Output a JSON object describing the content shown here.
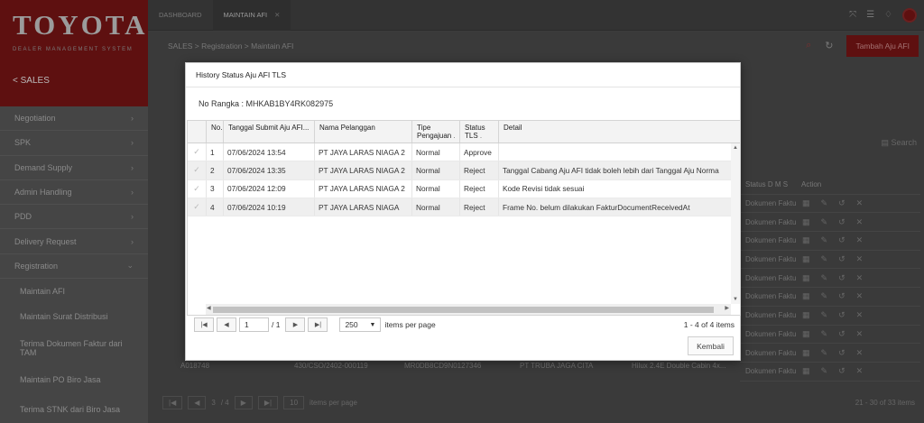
{
  "brand": {
    "name": "TOYOTA",
    "subtitle": "DEALER MANAGEMENT SYSTEM"
  },
  "sidebar": {
    "section": "< SALES",
    "items": [
      {
        "label": "Negotiation"
      },
      {
        "label": "SPK"
      },
      {
        "label": "Demand Supply"
      },
      {
        "label": "Admin Handling"
      },
      {
        "label": "PDD"
      },
      {
        "label": "Delivery Request"
      },
      {
        "label": "Registration"
      }
    ],
    "subitems": [
      {
        "label": "Maintain AFI"
      },
      {
        "label": "Maintain Surat Distribusi"
      },
      {
        "label": "Terima Dokumen Faktur dari TAM"
      },
      {
        "label": "Maintain PO Biro Jasa"
      },
      {
        "label": "Terima STNK dari Biro Jasa"
      }
    ]
  },
  "tabs": [
    {
      "label": "DASHBOARD"
    },
    {
      "label": "MAINTAIN AFI"
    }
  ],
  "breadcrumb": "SALES > Registration > Maintain AFI",
  "add_button": "Tambah Aju AFI",
  "search_label": "Search",
  "bg_table": {
    "status_header": "Status D M S",
    "action_header": "Action",
    "status_value": "Dokumen Faktu",
    "last_row": [
      "A018748",
      "430/CSO/2402-000119",
      "MR0DB8CD9N0127346",
      "PT TRUBA JAGA CITA",
      "Hilux 2.4E Double Cabin 4x..."
    ],
    "pager": {
      "page": "3",
      "total": "4",
      "size": "10",
      "items_label": "items per page",
      "range": "21 - 30 of 33 items"
    }
  },
  "modal": {
    "title": "History Status Aju AFI TLS",
    "rangka_label": "No Rangka : ",
    "rangka_value": "MHKAB1BY4RK082975",
    "headers": {
      "no": "No.",
      "tanggal": "Tanggal Submit Aju AFI...",
      "nama": "Nama Pelanggan",
      "tipe": "Tipe Pengajuan",
      "status": "Status TLS",
      "detail": "Detail"
    },
    "rows": [
      {
        "no": "1",
        "tanggal": "07/06/2024 13:54",
        "nama": "PT JAYA LARAS NIAGA 2",
        "tipe": "Normal",
        "status": "Approve",
        "detail": ""
      },
      {
        "no": "2",
        "tanggal": "07/06/2024 13:35",
        "nama": "PT JAYA LARAS NIAGA 2",
        "tipe": "Normal",
        "status": "Reject",
        "detail": "Tanggal Cabang Aju AFI tidak boleh lebih dari Tanggal Aju Norma"
      },
      {
        "no": "3",
        "tanggal": "07/06/2024 12:09",
        "nama": "PT JAYA LARAS NIAGA 2",
        "tipe": "Normal",
        "status": "Reject",
        "detail": "Kode Revisi tidak sesuai"
      },
      {
        "no": "4",
        "tanggal": "07/06/2024 10:19",
        "nama": "PT JAYA LARAS NIAGA",
        "tipe": "Normal",
        "status": "Reject",
        "detail": "Frame No. belum dilakukan FakturDocumentReceivedAt"
      }
    ],
    "pager": {
      "page": "1",
      "of_label": "/ 1",
      "page_size": "250",
      "items_label": "items per page",
      "range": "1 - 4 of 4 items"
    },
    "back_button": "Kembali"
  }
}
